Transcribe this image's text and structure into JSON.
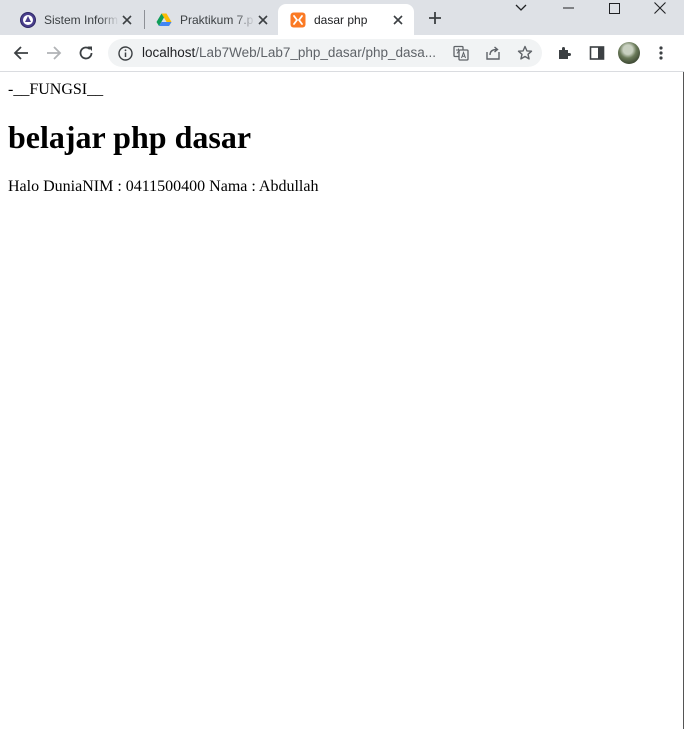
{
  "browser": {
    "tabs": [
      {
        "title": "Sistem Inform",
        "icon": "university-logo-icon",
        "active": false
      },
      {
        "title": "Praktikum 7.p",
        "icon": "google-drive-icon",
        "active": false
      },
      {
        "title": "dasar php",
        "icon": "xampp-icon",
        "active": true
      }
    ],
    "address": {
      "host": "localhost",
      "path": "/Lab7Web/Lab7_php_dasar/php_dasa..."
    },
    "colors": {
      "tabstrip_bg": "#dee1e6",
      "omnibox_bg": "#f1f3f4",
      "xampp_orange": "#fb7a24"
    }
  },
  "page": {
    "line1": "-__FUNGSI__",
    "heading": "belajar php dasar",
    "line3": "Halo DuniaNIM : 0411500400 Nama : Abdullah"
  }
}
